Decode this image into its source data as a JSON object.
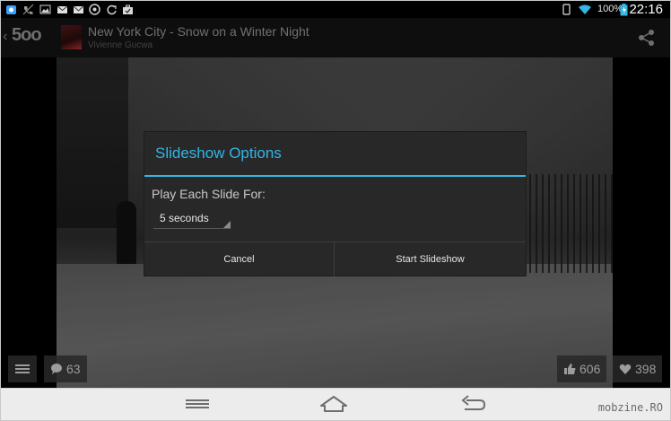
{
  "status_bar": {
    "battery": "100%",
    "time": "22:16",
    "icons": [
      "app-icon",
      "phone-icon",
      "image-icon",
      "mail-icon",
      "gmail-icon",
      "chrome-icon",
      "refresh-icon",
      "briefcase-icon",
      "tablet-icon",
      "wifi-icon",
      "battery-icon"
    ]
  },
  "action_bar": {
    "logo": "5oo",
    "title": "New York City - Snow on a Winter Night",
    "author": "Vivienne Gucwa"
  },
  "photo_overlay": {
    "comments_count": "63",
    "likes_count": "606",
    "favorites_count": "398"
  },
  "dialog": {
    "title": "Slideshow Options",
    "label": "Play Each Slide For:",
    "selected_duration": "5 seconds",
    "cancel_label": "Cancel",
    "start_label": "Start Slideshow"
  },
  "navigation_bar": {
    "watermark": "mobzine.RO"
  },
  "colors": {
    "accent": "#33b5e5",
    "dialog_bg": "#282828",
    "status_bar": "#000000",
    "action_bar": "#141414",
    "nav_bar": "#ececec"
  }
}
